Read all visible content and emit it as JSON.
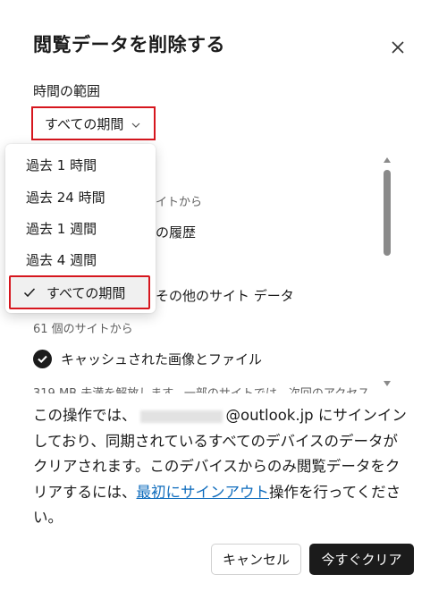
{
  "dialog": {
    "title": "閲覧データを削除する",
    "close_icon": "close-icon"
  },
  "time_range": {
    "label": "時間の範囲",
    "selected": "すべての期間",
    "options": [
      "過去 1 時間",
      "過去 24 時間",
      "過去 1 週間",
      "過去 4 週間",
      "すべての期間"
    ]
  },
  "list": {
    "partial_sub_1": "イトから",
    "partial_title_1": "の履歴",
    "partial_title_2": "その他のサイト データ",
    "cookies_sub": "61 個のサイトから",
    "cache_title": "キャッシュされた画像とファイル",
    "cache_sub": "319 MB 未満を解放します。一部のサイトでは、次回のアクセス"
  },
  "info": {
    "text_1": "この操作では、",
    "email_suffix": "@outlook.jp",
    "text_2": " にサインインしており、同期されているすべてのデバイスのデータがクリアされます。このデバイスからのみ閲覧データをクリアするには、",
    "link": "最初にサインアウト",
    "text_3": "操作を行ってください。"
  },
  "buttons": {
    "cancel": "キャンセル",
    "clear": "今すぐクリア"
  },
  "colors": {
    "accent_red": "#d6161e",
    "link": "#0f6cbd",
    "primary_button": "#1b1b1b"
  }
}
